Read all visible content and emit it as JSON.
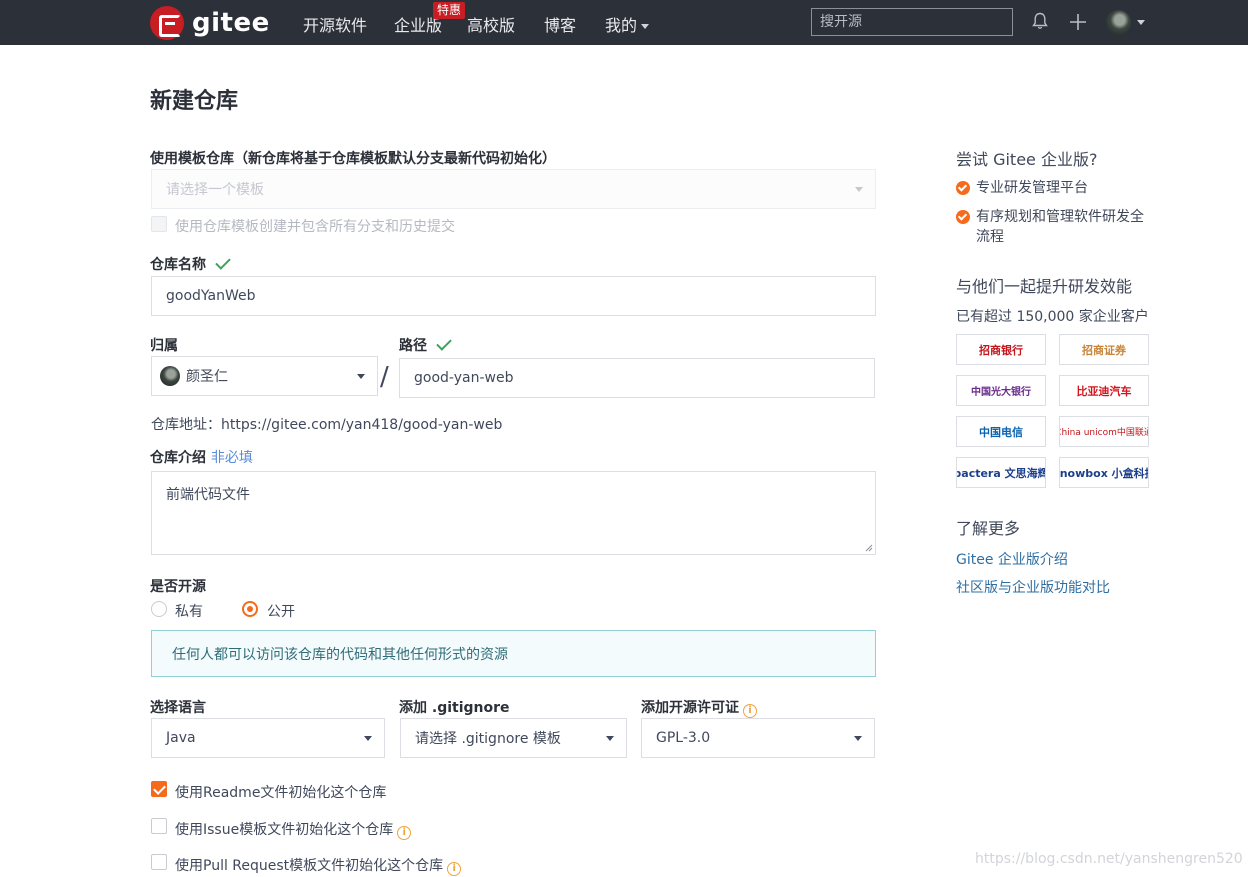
{
  "nav": {
    "logo_text": "gitee",
    "items": [
      "开源软件",
      "企业版",
      "高校版",
      "博客",
      "我的"
    ],
    "enterprise_tag": "特惠",
    "search_placeholder": "搜开源"
  },
  "page_title": "新建仓库",
  "template": {
    "label": "使用模板仓库（新仓库将基于仓库模板默认分支最新代码初始化）",
    "placeholder": "请选择一个模板",
    "include_all_label": "使用仓库模板创建并包含所有分支和历史提交"
  },
  "repo_name": {
    "label": "仓库名称",
    "value": "goodYanWeb"
  },
  "owner": {
    "label": "归属",
    "value": "颜圣仁"
  },
  "path": {
    "label": "路径",
    "value": "good-yan-web",
    "separator": "/"
  },
  "repo_url": "仓库地址：https://gitee.com/yan418/good-yan-web",
  "intro": {
    "label": "仓库介绍",
    "optional": "非必填",
    "value": "前端代码文件"
  },
  "visibility": {
    "label": "是否开源",
    "private": "私有",
    "public": "公开",
    "notice": "任何人都可以访问该仓库的代码和其他任何形式的资源"
  },
  "language": {
    "label": "选择语言",
    "value": "Java"
  },
  "gitignore": {
    "label": "添加 .gitignore",
    "value": "请选择 .gitignore 模板"
  },
  "license": {
    "label": "添加开源许可证",
    "value": "GPL-3.0"
  },
  "init_options": [
    {
      "label": "使用Readme文件初始化这个仓库",
      "checked": true
    },
    {
      "label": "使用Issue模板文件初始化这个仓库",
      "checked": false
    },
    {
      "label": "使用Pull Request模板文件初始化这个仓库",
      "checked": false
    }
  ],
  "sidebar": {
    "try_title": "尝试 Gitee 企业版?",
    "features": [
      "专业研发管理平台",
      "有序规划和管理软件研发全流程"
    ],
    "efficiency_title": "与他们一起提升研发效能",
    "customers_text": "已有超过 150,000 家企业客户",
    "customer_logos": [
      "招商银行",
      "招商证券",
      "中国光大银行",
      "比亚迪汽车",
      "中国电信",
      "China unicom中国联通",
      "pactera 文思海辉",
      "knowbox 小盒科技"
    ],
    "more_title": "了解更多",
    "links": [
      "Gitee 企业版介绍",
      "社区版与企业版功能对比"
    ]
  },
  "watermark": "https://blog.csdn.net/yanshengren520"
}
